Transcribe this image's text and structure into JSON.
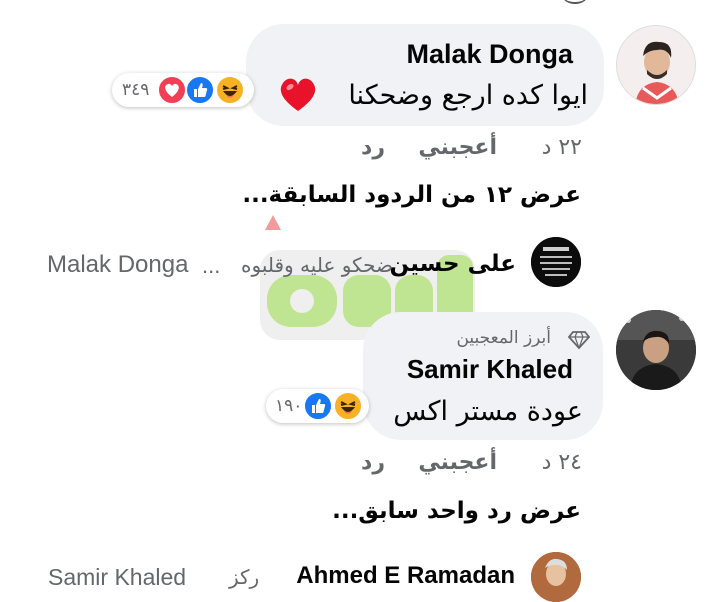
{
  "comments": [
    {
      "author": "Malak Donga",
      "text": "ايوا كده ارجع وضحكنا",
      "reactions": {
        "icons": [
          "haha-icon",
          "like-icon",
          "love-icon"
        ],
        "count": "٣٤٩"
      },
      "time": "٢٢ د",
      "like_label": "أعجبني",
      "reply_label": "رد"
    },
    {
      "badge": "أبرز المعجبين",
      "author": "Samir Khaled",
      "text": "عودة مستر اكس",
      "reactions": {
        "icons": [
          "haha-icon",
          "like-icon"
        ],
        "count": "١٩٠"
      },
      "time": "٢٤ د",
      "like_label": "أعجبني",
      "reply_label": "رد"
    }
  ],
  "view_previous_1": "عرض ١٢ من الردود السابقة...",
  "reply_preview": {
    "author": "على حسين",
    "text": "ضحكو عليه وقلبوه",
    "ellipsis": "...",
    "mention": "Malak Donga"
  },
  "view_previous_2": "عرض رد واحد سابق...",
  "bottom_partial": {
    "author": "Ahmed E Ramadan",
    "prefix": "ركز",
    "mention": "Samir Khaled"
  },
  "colors": {
    "bubble": "#f0f2f5",
    "secondary_text": "#65676b",
    "like_blue": "#1877f2",
    "love_red": "#f33e58",
    "haha_yellow": "#f7b125"
  }
}
